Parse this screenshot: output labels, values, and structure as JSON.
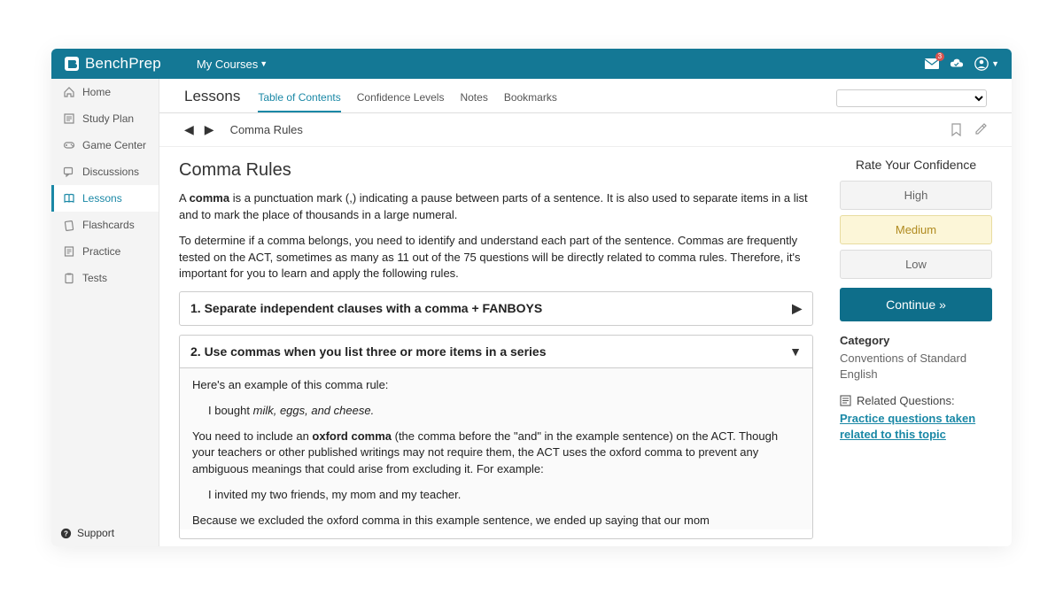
{
  "brand": "BenchPrep",
  "topnav": {
    "mycourses": "My Courses"
  },
  "notifications_count": "3",
  "sidebar": {
    "items": [
      {
        "label": "Home",
        "active": false
      },
      {
        "label": "Study Plan",
        "active": false
      },
      {
        "label": "Game Center",
        "active": false
      },
      {
        "label": "Discussions",
        "active": false
      },
      {
        "label": "Lessons",
        "active": true
      },
      {
        "label": "Flashcards",
        "active": false
      },
      {
        "label": "Practice",
        "active": false
      },
      {
        "label": "Tests",
        "active": false
      }
    ],
    "support": "Support"
  },
  "page": {
    "title": "Lessons",
    "tabs": [
      {
        "label": "Table of Contents",
        "active": true
      },
      {
        "label": "Confidence Levels",
        "active": false
      },
      {
        "label": "Notes",
        "active": false
      },
      {
        "label": "Bookmarks",
        "active": false
      }
    ],
    "dropdown_placeholder": ""
  },
  "crumb": {
    "title": "Comma Rules"
  },
  "lesson": {
    "heading": "Comma Rules",
    "p1_a": "A ",
    "p1_b": "comma",
    "p1_c": " is a punctuation mark (,) indicating a pause between parts of a sentence. It is also used to separate items in a list and to mark the place of thousands in a large numeral.",
    "p2": "To determine if a comma belongs, you need to identify and understand each part of the sentence. Commas are frequently tested on the ACT, sometimes as many as 11 out of the 75 questions will be directly related to comma rules. Therefore, it's important for you to learn and apply the following rules.",
    "acc1_title": "1. Separate independent clauses with a comma + FANBOYS",
    "acc2_title": "2. Use commas when you list three or more items in a series",
    "acc2": {
      "p1": "Here's an example of this comma rule:",
      "ex1_a": "I bought ",
      "ex1_b": "milk, eggs, and cheese.",
      "p2_a": "You need to include an ",
      "p2_b": "oxford comma",
      "p2_c": " (the comma before the \"and\" in the example sentence) on the ACT. Though your teachers or other published writings may not require them, the ACT uses the oxford comma to prevent any ambiguous meanings that could arise from excluding it. For example:",
      "ex2": "I invited my two friends, my mom and my teacher.",
      "p3": "Because we excluded the oxford comma in this example sentence, we ended up saying that our mom"
    }
  },
  "rail": {
    "confidence_title": "Rate Your Confidence",
    "levels": {
      "high": "High",
      "medium": "Medium",
      "low": "Low"
    },
    "continue": "Continue",
    "category_title": "Category",
    "category_body": "Conventions of Standard English",
    "related_title": "Related Questions:",
    "related_link": "Practice questions taken related to this topic"
  }
}
